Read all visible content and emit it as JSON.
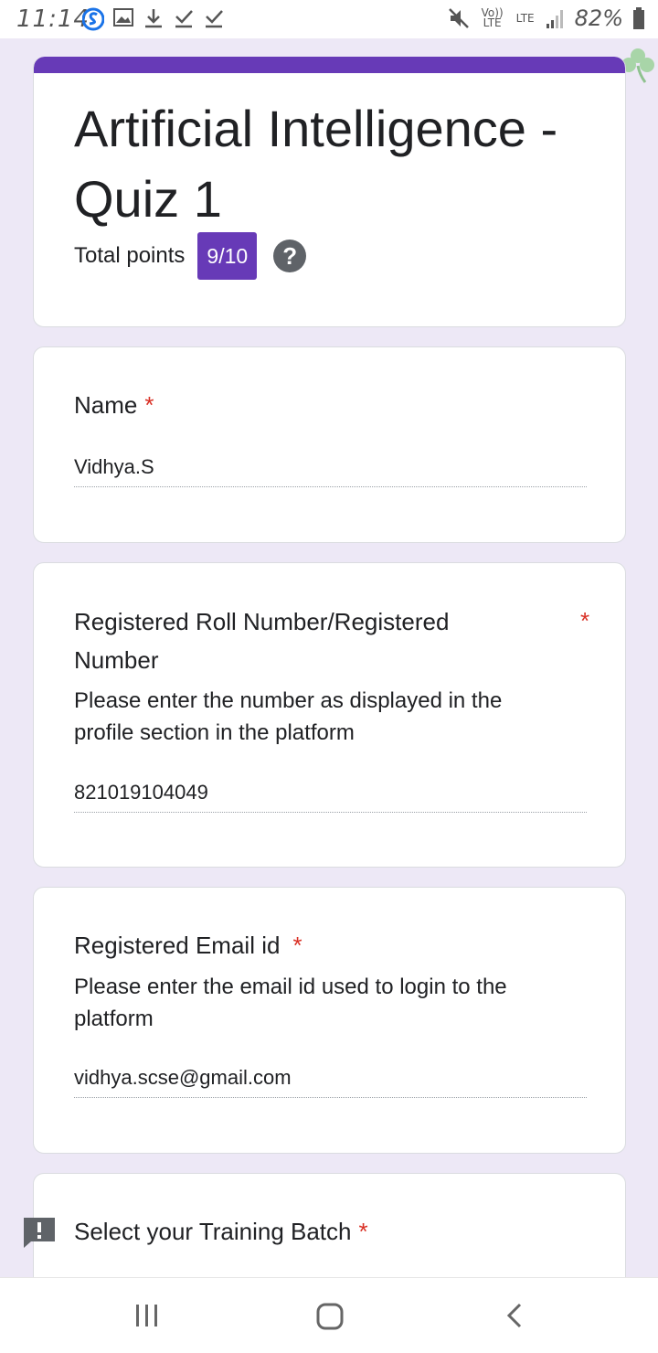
{
  "status_bar": {
    "time": "11:14",
    "network_1": "Vo)) LTE",
    "network_2": "LTE",
    "battery": "82%"
  },
  "form": {
    "title": "Artificial Intelligence - Quiz 1",
    "total_points_label": "Total points",
    "score": "9/10",
    "help_icon": "?"
  },
  "questions": [
    {
      "title": "Name",
      "required_mark": "*",
      "answer": "Vidhya.S"
    },
    {
      "title": "Registered Roll Number/Registered Number",
      "required_mark": "*",
      "description": "Please enter the number as displayed in the profile section in the platform",
      "answer": "821019104049"
    },
    {
      "title": "Registered Email id",
      "required_mark": "*",
      "description": "Please enter the email id used to login to the platform",
      "answer": "vidhya.scse@gmail.com"
    },
    {
      "title": "Select your Training Batch",
      "required_mark": "*"
    }
  ],
  "colors": {
    "accent": "#673ab7",
    "background": "#ede8f6",
    "required": "#d93025"
  },
  "icons": {
    "status": [
      "s-app-icon",
      "image-icon",
      "download-icon",
      "check-icon",
      "check-icon",
      "mute-icon",
      "signal-icon",
      "battery-icon"
    ],
    "navigation": [
      "recents-icon",
      "home-icon",
      "back-icon"
    ],
    "feedback": "feedback-flag-icon",
    "decoration": "clover-icon"
  }
}
